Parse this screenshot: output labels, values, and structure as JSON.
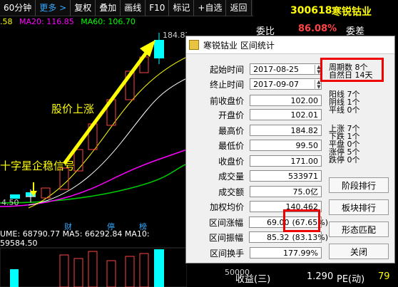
{
  "toolbar": {
    "period": "60分钟",
    "more": "更多",
    "arrow": ">",
    "items": [
      "复权",
      "叠加",
      "画线",
      "F10",
      "标记",
      "+自选",
      "返回"
    ]
  },
  "header": {
    "code": "300618",
    "name": "寒锐钴业",
    "weibi_label": "委比",
    "weibi_value": "86.08%",
    "weicha_label": "委差"
  },
  "ma": {
    "ma5": ".58",
    "ma20": "MA20: 116.85",
    "ma60": "MA60: 106.70"
  },
  "chart": {
    "peak_label": "184.82",
    "annotation_rise": "股价上涨",
    "annotation_signal": "十字星企稳信号",
    "low_label": "4.50",
    "markers": [
      "财",
      "停",
      "榜"
    ],
    "volume_line": "UME: 68790.77  MA5: 66292.84  MA10: 59584.50",
    "vol_axis": "50000"
  },
  "dialog": {
    "title": "寒锐钴业 区间统计",
    "rows": [
      {
        "label": "起始时间",
        "value": "2017-08-25"
      },
      {
        "label": "终止时间",
        "value": "2017-09-07"
      },
      {
        "label": "前收盘价",
        "value": "102.00"
      },
      {
        "label": "开盘价",
        "value": "102.01"
      },
      {
        "label": "最高价",
        "value": "184.82"
      },
      {
        "label": "最低价",
        "value": "99.50"
      },
      {
        "label": "收盘价",
        "value": "171.00"
      },
      {
        "label": "成交量",
        "value": "533971"
      },
      {
        "label": "成交额",
        "value": "75.0亿"
      },
      {
        "label": "加权均价",
        "value": "140.462"
      },
      {
        "label": "区间涨幅",
        "value": "69.00",
        "extra": "67.65%"
      },
      {
        "label": "区间振幅",
        "value": "85.32",
        "extra": "83.13%"
      },
      {
        "label": "区间换手",
        "value": "177.99%"
      }
    ],
    "period": {
      "l1": "周期数",
      "v1": "8个",
      "l2": "自然日",
      "v2": "14天"
    },
    "stats1": [
      {
        "l": "阳线",
        "v": "7个"
      },
      {
        "l": "阴线",
        "v": "1个"
      },
      {
        "l": "平线",
        "v": "0个"
      }
    ],
    "stats2": [
      {
        "l": "上涨",
        "v": "7个"
      },
      {
        "l": "下跌",
        "v": "1个"
      },
      {
        "l": "平盘",
        "v": "0个"
      },
      {
        "l": "涨停",
        "v": "5个"
      },
      {
        "l": "跌停",
        "v": "0个"
      }
    ],
    "buttons": [
      "阶段排行",
      "板块排行",
      "形态匹配",
      "关闭"
    ]
  },
  "bottomright": {
    "label": "收益(三)",
    "value": "1.290",
    "pe": "PE(动)",
    "pe_value": "79"
  }
}
